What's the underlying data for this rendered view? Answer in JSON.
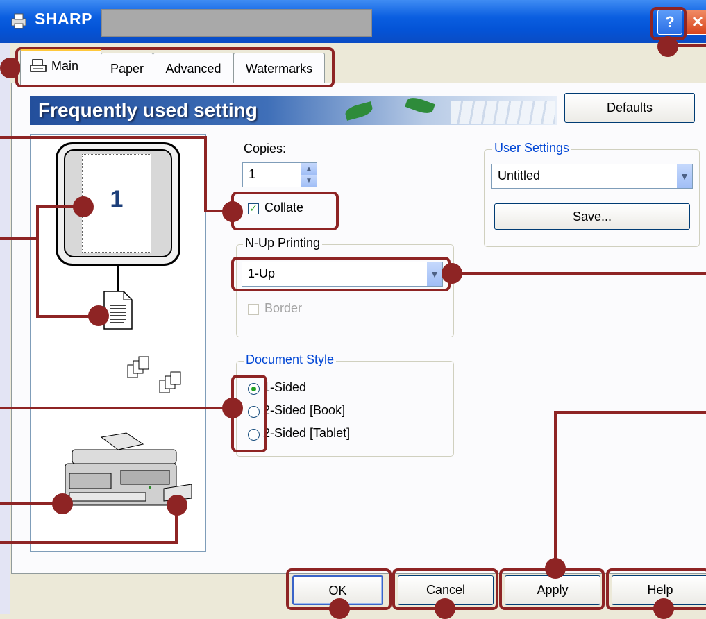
{
  "window": {
    "title": "SHARP",
    "help_glyph": "?",
    "close_glyph": "✕"
  },
  "tabs": [
    {
      "label": "Main",
      "active": true
    },
    {
      "label": "Paper",
      "active": false
    },
    {
      "label": "Advanced",
      "active": false
    },
    {
      "label": "Watermarks",
      "active": false
    }
  ],
  "banner": {
    "title": "Frequently used setting"
  },
  "buttons": {
    "defaults": "Defaults",
    "save": "Save...",
    "ok": "OK",
    "cancel": "Cancel",
    "apply": "Apply",
    "help": "Help"
  },
  "preview": {
    "page_number": "1"
  },
  "copies": {
    "label": "Copies:",
    "value": "1"
  },
  "collate": {
    "label": "Collate",
    "checked": true
  },
  "user_settings": {
    "label": "User Settings",
    "selected": "Untitled"
  },
  "nup": {
    "label": "N-Up Printing",
    "selected": "1-Up",
    "border_label": "Border",
    "border_enabled": false
  },
  "document_style": {
    "label": "Document Style",
    "options": [
      {
        "label": "1-Sided",
        "selected": true
      },
      {
        "label": "2-Sided [Book]",
        "selected": false
      },
      {
        "label": "2-Sided [Tablet]",
        "selected": false
      }
    ]
  },
  "colors": {
    "callout": "#8e2424",
    "titlebar": "#0a5ee0",
    "group_label": "#0046d5"
  }
}
